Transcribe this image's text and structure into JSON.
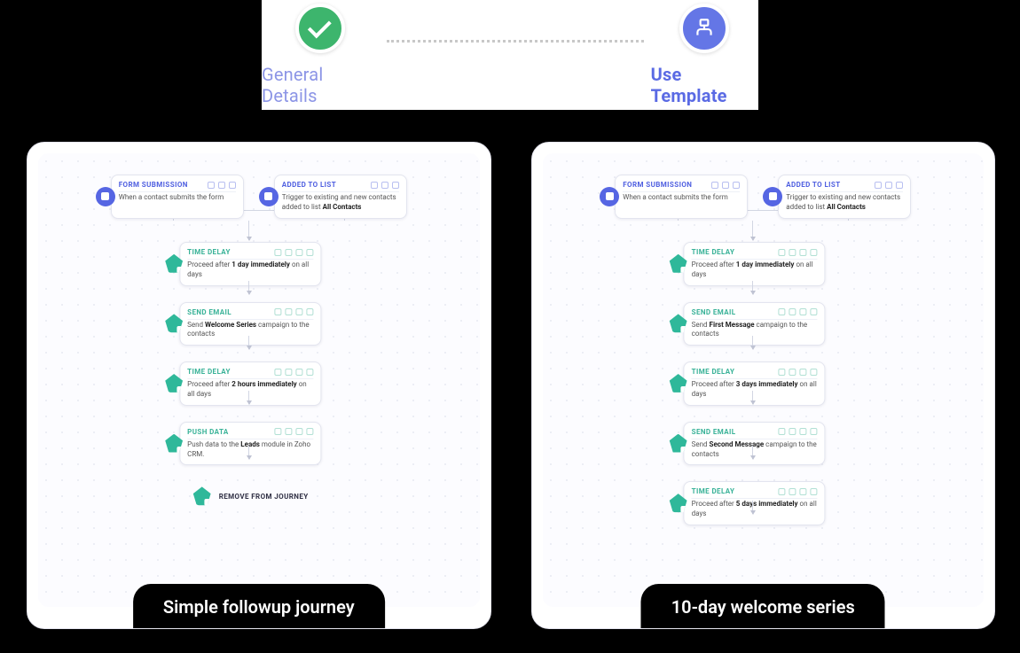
{
  "stepper": {
    "step1_label": "General Details",
    "step2_label": "Use Template"
  },
  "templates": [
    {
      "title": "Simple followup  journey",
      "triggers": [
        {
          "title": "FORM SUBMISSION",
          "body_pre": "When a contact submits the form",
          "body_bold": "",
          "body_post": ""
        },
        {
          "title": "ADDED TO LIST",
          "body_pre": "Trigger to existing and new contacts added to list ",
          "body_bold": "All Contacts",
          "body_post": ""
        }
      ],
      "steps": [
        {
          "title": "TIME DELAY",
          "body_pre": "Proceed after ",
          "body_bold": "1 day immediately",
          "body_post": " on all days"
        },
        {
          "title": "SEND EMAIL",
          "body_pre": "Send ",
          "body_bold": "Welcome Series",
          "body_post": " campaign to the contacts"
        },
        {
          "title": "TIME DELAY",
          "body_pre": "Proceed after ",
          "body_bold": "2 hours immediately",
          "body_post": " on all days"
        },
        {
          "title": "PUSH DATA",
          "body_pre": "Push data to the ",
          "body_bold": "Leads",
          "body_post": " module in Zoho CRM."
        }
      ],
      "end_label": "REMOVE FROM JOURNEY"
    },
    {
      "title": "10-day welcome series",
      "triggers": [
        {
          "title": "FORM SUBMISSION",
          "body_pre": "When a contact submits the form",
          "body_bold": "",
          "body_post": ""
        },
        {
          "title": "ADDED TO LIST",
          "body_pre": "Trigger to existing and new contacts added to list ",
          "body_bold": "All Contacts",
          "body_post": ""
        }
      ],
      "steps": [
        {
          "title": "TIME DELAY",
          "body_pre": "Proceed after ",
          "body_bold": "1 day immediately",
          "body_post": " on all days"
        },
        {
          "title": "SEND EMAIL",
          "body_pre": "Send ",
          "body_bold": "First Message",
          "body_post": " campaign to the contacts"
        },
        {
          "title": "TIME DELAY",
          "body_pre": "Proceed after ",
          "body_bold": "3 days immediately",
          "body_post": " on all days"
        },
        {
          "title": "SEND EMAIL",
          "body_pre": "Send ",
          "body_bold": "Second Message",
          "body_post": " campaign to the contacts"
        },
        {
          "title": "TIME DELAY",
          "body_pre": "Proceed after ",
          "body_bold": "5 days immediately",
          "body_post": " on all days"
        }
      ],
      "end_label": ""
    }
  ]
}
